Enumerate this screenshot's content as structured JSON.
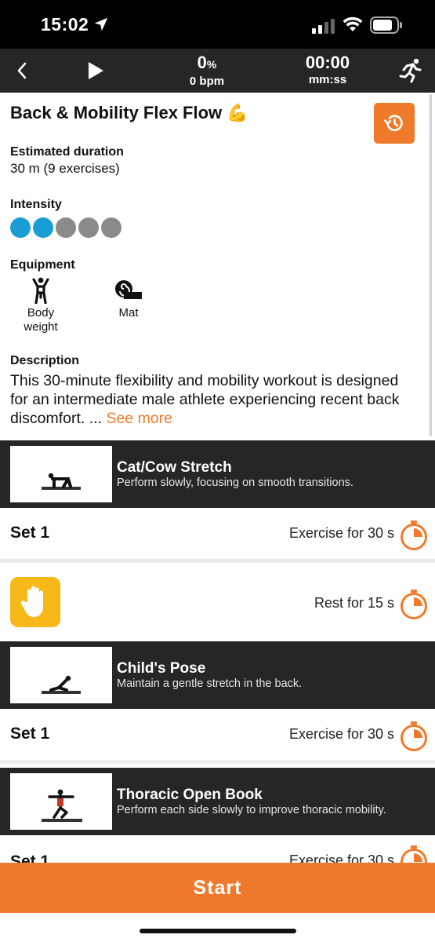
{
  "status": {
    "time": "15:02"
  },
  "player": {
    "progress_pct": "0",
    "pct_unit": "%",
    "bpm": "0 bpm",
    "elapsed": "00:00",
    "elapsed_unit": "mm:ss"
  },
  "workout": {
    "title": "Back & Mobility Flex Flow 💪",
    "duration_label": "Estimated duration",
    "duration_value": "30 m (9 exercises)",
    "intensity_label": "Intensity",
    "intensity_level": 2,
    "intensity_max": 5,
    "equipment_label": "Equipment",
    "equipment": [
      "Body weight",
      "Mat"
    ],
    "description_label": "Description",
    "description": "This 30-minute flexibility and mobility workout is designed for an intermediate male athlete experiencing recent back discomfort. ...",
    "see_more": "See more"
  },
  "exercises": [
    {
      "name": "Cat/Cow Stretch",
      "desc": "Perform slowly, focusing on smooth transitions.",
      "set_label": "Set 1",
      "set_text": "Exercise for 30 s"
    },
    {
      "name": "Child's Pose",
      "desc": "Maintain a gentle stretch in the back.",
      "set_label": "Set 1",
      "set_text": "Exercise for 30 s"
    },
    {
      "name": "Thoracic Open Book",
      "desc": "Perform each side slowly to improve thoracic mobility.",
      "set_label": "Set 1",
      "set_text": "Exercise for 30 s"
    }
  ],
  "rest": {
    "text": "Rest for 15 s"
  },
  "start_label": "Start",
  "colors": {
    "accent": "#f07a2b",
    "intensity_on": "#1a9dd4",
    "intensity_off": "#8a8a8a",
    "rest": "#f7b819",
    "header": "#262626"
  }
}
